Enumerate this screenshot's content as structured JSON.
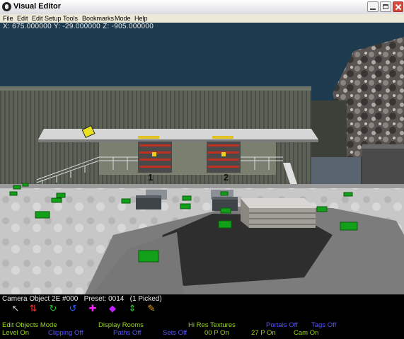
{
  "window": {
    "title": "Visual Editor"
  },
  "menu": [
    "File",
    "Edit",
    "Edit Setup",
    "Tools",
    "Bookmarks",
    "Mode",
    "Help"
  ],
  "viewport": {
    "coordinates": "X: 675.000000 Y: -29.000000 Z: -905.000000",
    "door_labels": [
      "1",
      "2"
    ]
  },
  "status": {
    "selection": "Camera Object 2E #000   Preset: 0014   (1 Picked)",
    "tools": [
      "pointer-icon",
      "move-vertical-icon",
      "rotate-green-icon",
      "rotate-blue-icon",
      "move-cross-icon",
      "scale-icon",
      "move-updown-icon",
      "brush-icon"
    ],
    "flags": [
      {
        "label": "Edit Objects Mode",
        "state": "on"
      },
      {
        "label": "Display Rooms",
        "state": "on"
      },
      {
        "label": "Hi Res Textures",
        "state": "on"
      },
      {
        "label": "Portals Off",
        "state": "off"
      },
      {
        "label": "Tags Off",
        "state": "off"
      },
      {
        "label": "Level On",
        "state": "on"
      },
      {
        "label": "Clipping Off",
        "state": "off"
      },
      {
        "label": "Paths Off",
        "state": "off"
      },
      {
        "label": "Sets Off",
        "state": "off"
      },
      {
        "label": "00 P On",
        "state": "on"
      },
      {
        "label": "27 P On",
        "state": "on"
      },
      {
        "label": "Cam On",
        "state": "on"
      }
    ]
  },
  "colors": {
    "flag_on": "#9ad81a",
    "flag_off": "#5555ff",
    "sky": "#1e3a4f",
    "object_green": "#12a018"
  }
}
